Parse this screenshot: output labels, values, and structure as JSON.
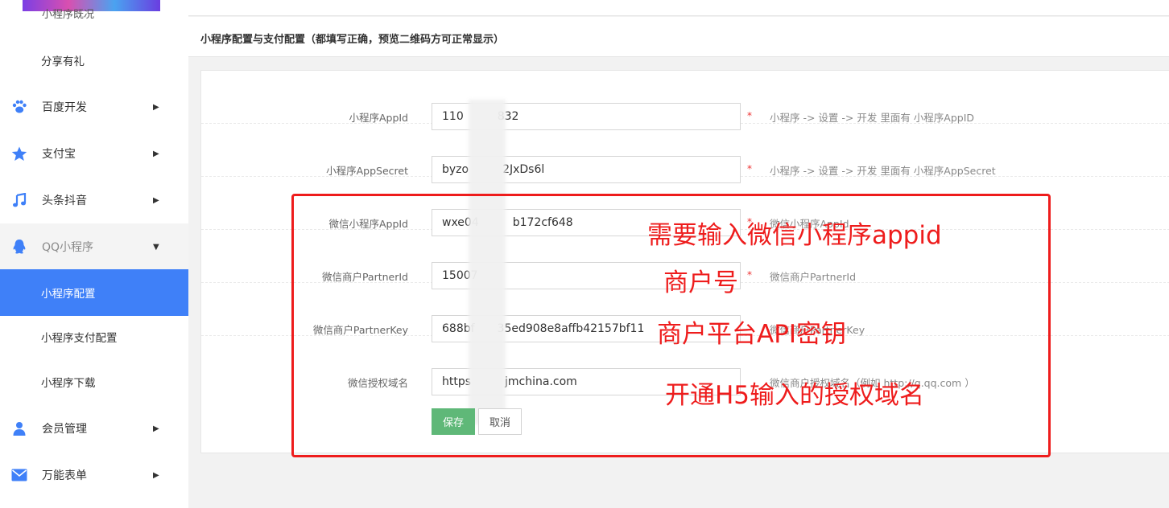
{
  "sidebar": {
    "clipped_item": "小程序既况",
    "items": [
      {
        "label": "分享有礼",
        "icon": "",
        "arrow": "",
        "state": "sub"
      },
      {
        "label": "百度开发",
        "icon": "paw-icon",
        "arrow": "▶",
        "state": "normal"
      },
      {
        "label": "支付宝",
        "icon": "star-icon",
        "arrow": "▶",
        "state": "normal"
      },
      {
        "label": "头条抖音",
        "icon": "music-note-icon",
        "arrow": "▶",
        "state": "normal"
      },
      {
        "label": "QQ小程序",
        "icon": "qq-penguin-icon",
        "arrow": "▼",
        "state": "open"
      },
      {
        "label": "小程序配置",
        "icon": "",
        "arrow": "",
        "state": "active"
      },
      {
        "label": "小程序支付配置",
        "icon": "",
        "arrow": "",
        "state": "sub"
      },
      {
        "label": "小程序下载",
        "icon": "",
        "arrow": "",
        "state": "sub"
      },
      {
        "label": "会员管理",
        "icon": "user-icon",
        "arrow": "▶",
        "state": "normal"
      },
      {
        "label": "万能表单",
        "icon": "mail-icon",
        "arrow": "▶",
        "state": "normal"
      }
    ]
  },
  "page": {
    "title": "小程序配置与支付配置（都填写正确，预览二维码方可正常显示）"
  },
  "form": {
    "fields": [
      {
        "label": "小程序AppId",
        "value": "110　　　832",
        "required": "*",
        "hint": "小程序 -> 设置 -> 开发 里面有 小程序AppID"
      },
      {
        "label": "小程序AppSecret",
        "value": "byzo　　　2JxDs6l",
        "required": "*",
        "hint": "小程序 -> 设置 -> 开发 里面有 小程序AppSecret"
      },
      {
        "label": "微信小程序AppId",
        "value": "wxe04　　　b172cf648",
        "required": "*",
        "hint": "微信小程序AppId"
      },
      {
        "label": "微信商户PartnerId",
        "value": "15007",
        "required": "*",
        "hint": "微信商户PartnerId"
      },
      {
        "label": "微信商户PartnerKey",
        "value": "688bf　　35ed908e8affb42157bf11",
        "required": "",
        "hint": "微信商户PartnerKey"
      },
      {
        "label": "微信授权域名",
        "value": "https　　　jmchina.com",
        "required": "",
        "hint": "微信商户授权域名（例如 http://q.qq.com ）"
      }
    ],
    "save_label": "保存",
    "cancel_label": "取消"
  },
  "annotations": {
    "appid": "需要输入微信小程序appid",
    "merchant": "商户号",
    "apikey": "商户平台API密钥",
    "domain": "开通H5输入的授权域名"
  },
  "colors": {
    "sidebar_active": "#3f80f8",
    "icon_blue": "#3f80f8",
    "save_green": "#5fb878",
    "annotation_red": "#ee1c1c"
  }
}
